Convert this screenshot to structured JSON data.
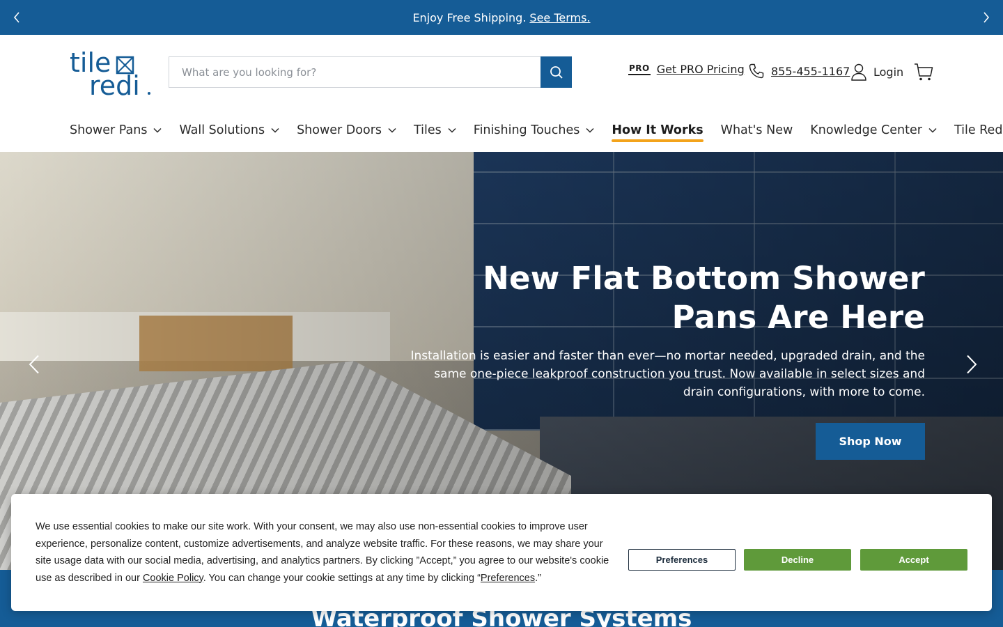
{
  "colors": {
    "brand_blue": "#155c96",
    "accent_orange": "#f3a31b",
    "cookie_green": "#5f9a3a"
  },
  "announcement": {
    "message": "Enjoy Free Shipping.",
    "link_label": "See Terms.",
    "prev_icon": "chevron-left-icon",
    "next_icon": "chevron-right-icon"
  },
  "header": {
    "logo": {
      "line1": "tile",
      "line2": "redi"
    },
    "search": {
      "placeholder": "What are you looking for?",
      "value": ""
    },
    "pro": {
      "badge": "PRO",
      "label": "Get PRO Pricing"
    },
    "phone": {
      "number": "855-455-1167"
    },
    "login": {
      "label": "Login"
    },
    "cart_icon": "cart-icon"
  },
  "nav": {
    "items": [
      {
        "label": "Shower Pans",
        "has_dropdown": true
      },
      {
        "label": "Wall Solutions",
        "has_dropdown": true
      },
      {
        "label": "Shower Doors",
        "has_dropdown": true
      },
      {
        "label": "Tiles",
        "has_dropdown": true
      },
      {
        "label": "Finishing Touches",
        "has_dropdown": true
      },
      {
        "label": "How It Works",
        "has_dropdown": false,
        "active": true
      },
      {
        "label": "What's New",
        "has_dropdown": false
      },
      {
        "label": "Knowledge Center",
        "has_dropdown": true
      },
      {
        "label": "Tile Redi PRO",
        "has_dropdown": true
      }
    ]
  },
  "hero": {
    "title": "New Flat Bottom Shower Pans Are Here",
    "body": "Installation is easier and faster than ever—no mortar needed, upgraded drain, and the same one-piece leakproof construction you trust. Now available in select sizes and drain configurations, with more to come.",
    "cta": "Shop Now"
  },
  "section": {
    "title": "Waterproof Shower Systems"
  },
  "cookie_banner": {
    "text_1": "We use essential cookies to make our site work. With your consent, we may also use non-essential cookies to improve user experience, personalize content, customize advertisements, and analyze website traffic. For these reasons, we may share your site usage data with our social media, advertising, and analytics partners. By clicking ”Accept,” you agree to our website's cookie use as described in our ",
    "policy_link": "Cookie Policy",
    "text_2": ". You can change your cookie settings at any time by clicking “",
    "preferences_link": "Preferences",
    "text_3": ".”",
    "buttons": {
      "preferences": "Preferences",
      "decline": "Decline",
      "accept": "Accept"
    }
  }
}
